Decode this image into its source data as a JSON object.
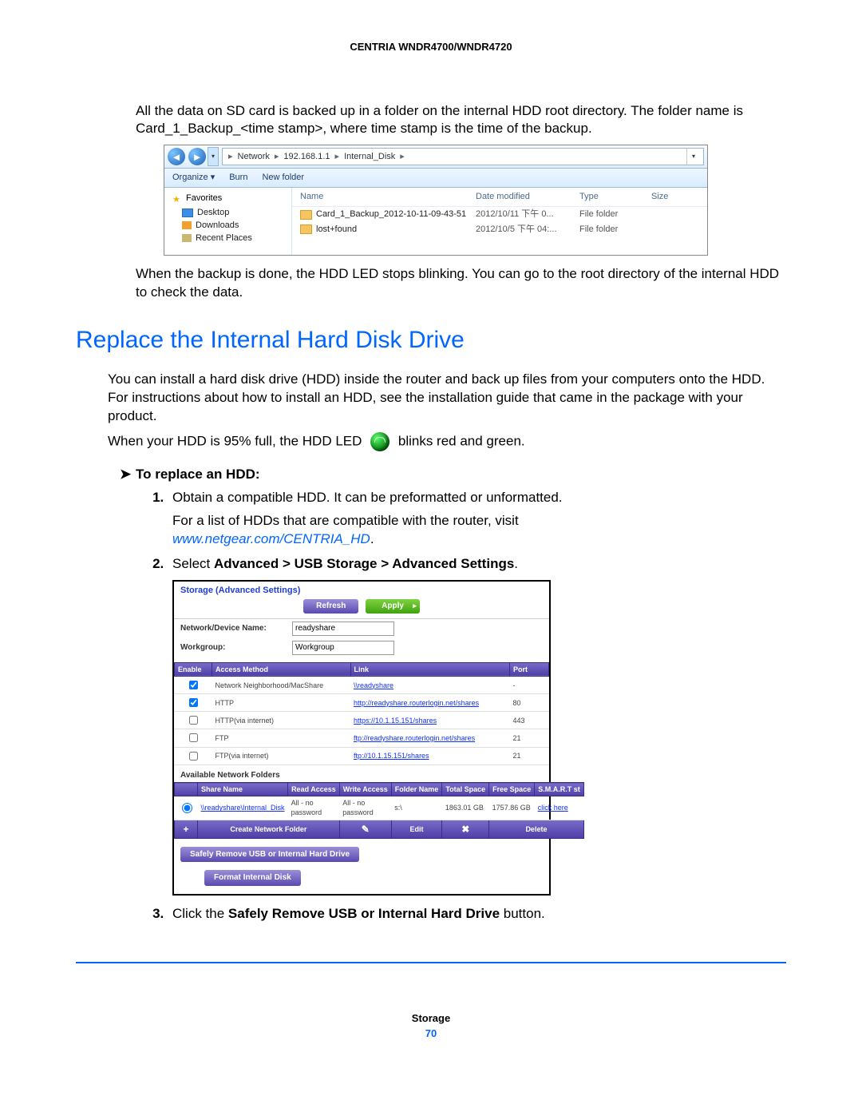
{
  "header": "CENTRIA WNDR4700/WNDR4720",
  "intro1": "All the data on SD card is backed up in a folder on the internal HDD root directory. The folder name is Card_1_Backup_<time stamp>, where time stamp is the time of the backup.",
  "explorer": {
    "breadcrumb": [
      "Network",
      "192.168.1.1",
      "Internal_Disk"
    ],
    "toolbar": {
      "organize": "Organize ▾",
      "burn": "Burn",
      "newfolder": "New folder"
    },
    "sidebar": {
      "favorites": "Favorites",
      "desktop": "Desktop",
      "downloads": "Downloads",
      "recent": "Recent Places"
    },
    "columns": {
      "name": "Name",
      "date": "Date modified",
      "type": "Type",
      "size": "Size"
    },
    "rows": [
      {
        "name": "Card_1_Backup_2012-10-11-09-43-51",
        "date": "2012/10/11 下午 0...",
        "type": "File folder",
        "size": ""
      },
      {
        "name": "lost+found",
        "date": "2012/10/5 下午 04:...",
        "type": "File folder",
        "size": ""
      }
    ]
  },
  "afterExplorer": "When the backup is done, the HDD LED stops blinking. You can go to the root directory of the internal HDD to check the data.",
  "sectionTitle": "Replace the Internal Hard Disk Drive",
  "sectionBody1": "You can install a hard disk drive (HDD) inside the router and back up files from your computers onto the HDD. For instructions about how to install an HDD, see the installation guide that came in the package with your product.",
  "ledLine": {
    "pre": "When your HDD is 95% full, the HDD LED",
    "post": "blinks red and green."
  },
  "taskTitle": "To replace an HDD:",
  "steps": {
    "s1": "Obtain a compatible HDD. It can be preformatted or unformatted.",
    "s1b": "For a list of HDDs that are compatible with the router, visit ",
    "s1link": "www.netgear.com/CENTRIA_HD",
    "s2pre": "Select ",
    "s2bold": "Advanced > USB Storage > Advanced Settings",
    "s3pre": "Click the ",
    "s3bold": "Safely Remove USB or Internal Hard Drive",
    "s3post": " button."
  },
  "router": {
    "title": "Storage (Advanced Settings)",
    "refresh": "Refresh",
    "apply": "Apply",
    "fields": {
      "devname_label": "Network/Device Name:",
      "devname_value": "readyshare",
      "workgroup_label": "Workgroup:",
      "workgroup_value": "Workgroup"
    },
    "cols": {
      "enable": "Enable",
      "method": "Access Method",
      "link": "Link",
      "port": "Port"
    },
    "methods": [
      {
        "chk": true,
        "name": "Network Neighborhood/MacShare",
        "link": "\\\\readyshare",
        "port": "-"
      },
      {
        "chk": true,
        "name": "HTTP",
        "link": "http://readyshare.routerlogin.net/shares",
        "port": "80"
      },
      {
        "chk": false,
        "name": "HTTP(via internet)",
        "link": "https://10.1.15.151/shares",
        "port": "443"
      },
      {
        "chk": false,
        "name": "FTP",
        "link": "ftp://readyshare.routerlogin.net/shares",
        "port": "21"
      },
      {
        "chk": false,
        "name": "FTP(via internet)",
        "link": "ftp://10.1.15.151/shares",
        "port": "21"
      }
    ],
    "avail": "Available Network Folders",
    "fcols": {
      "share": "Share Name",
      "read": "Read Access",
      "write": "Write Access",
      "folder": "Folder Name",
      "total": "Total Space",
      "free": "Free Space",
      "smart": "S.M.A.R.T st"
    },
    "folder": {
      "share": "\\\\readyshare\\Internal_Disk",
      "read": "All - no password",
      "write": "All - no password",
      "folder": "s:\\",
      "total": "1863.01 GB",
      "free": "1757.86 GB",
      "smart": "click here"
    },
    "actions": {
      "create": "Create Network Folder",
      "edit": "Edit",
      "delete": "Delete"
    },
    "safely": "Safely Remove USB or Internal Hard Drive",
    "format": "Format Internal Disk"
  },
  "footer": {
    "title": "Storage",
    "page": "70"
  }
}
